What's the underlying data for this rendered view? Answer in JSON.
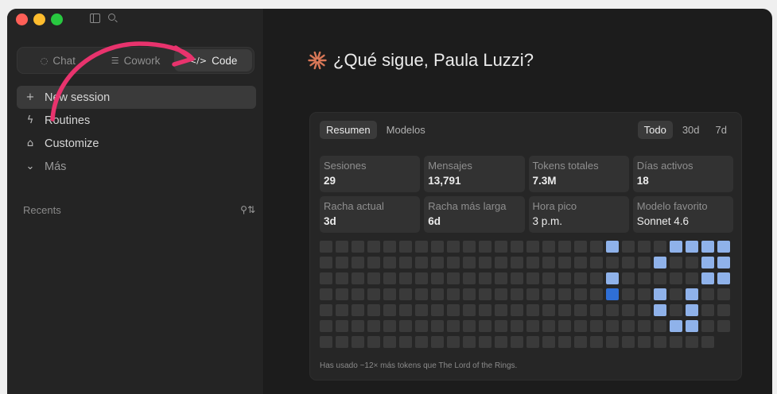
{
  "sidebar": {
    "modes": [
      {
        "icon": "chat-bubbles-icon",
        "glyph": "◌",
        "label": "Chat"
      },
      {
        "icon": "list-icon",
        "glyph": "☰",
        "label": "Cowork"
      },
      {
        "icon": "code-icon",
        "glyph": "</>",
        "label": "Code"
      }
    ],
    "nav": [
      {
        "icon": "plus-icon",
        "glyph": "+",
        "label": "New session"
      },
      {
        "icon": "bolt-icon",
        "glyph": "ϟ",
        "label": "Routines"
      },
      {
        "icon": "briefcase-icon",
        "glyph": "⌂",
        "label": "Customize"
      },
      {
        "icon": "chevron-down-icon",
        "glyph": "⌄",
        "label": "Más"
      }
    ],
    "recents_label": "Recents"
  },
  "main": {
    "greeting": "¿Qué sigue, Paula Luzzi?",
    "accent": "#d97757"
  },
  "stats_card": {
    "tabs_left": [
      "Resumen",
      "Modelos"
    ],
    "tabs_right": [
      "Todo",
      "30d",
      "7d"
    ],
    "stats": [
      {
        "label": "Sesiones",
        "value": "29"
      },
      {
        "label": "Mensajes",
        "value": "13,791"
      },
      {
        "label": "Tokens totales",
        "value": "7.3M"
      },
      {
        "label": "Días activos",
        "value": "18"
      },
      {
        "label": "Racha actual",
        "value": "3d"
      },
      {
        "label": "Racha más larga",
        "value": "6d"
      },
      {
        "label": "Hora pico",
        "value": "3 p.m."
      },
      {
        "label": "Modelo favorito",
        "value": "Sonnet 4.6"
      }
    ],
    "footnote": "Has usado ~12× más tokens que The Lord of the Rings.",
    "heatmap": {
      "weeks": 26,
      "days": 7,
      "colors": {
        "empty": "#3a3a3a",
        "light": "#8fb2ea",
        "strong": "#2f6fd6"
      },
      "active": [
        {
          "week": 18,
          "day": 0,
          "level": "light"
        },
        {
          "week": 18,
          "day": 2,
          "level": "light"
        },
        {
          "week": 18,
          "day": 3,
          "level": "strong"
        },
        {
          "week": 21,
          "day": 1,
          "level": "light"
        },
        {
          "week": 21,
          "day": 3,
          "level": "light"
        },
        {
          "week": 21,
          "day": 4,
          "level": "light"
        },
        {
          "week": 22,
          "day": 0,
          "level": "light"
        },
        {
          "week": 22,
          "day": 5,
          "level": "light"
        },
        {
          "week": 23,
          "day": 0,
          "level": "light"
        },
        {
          "week": 23,
          "day": 3,
          "level": "light"
        },
        {
          "week": 23,
          "day": 4,
          "level": "light"
        },
        {
          "week": 23,
          "day": 5,
          "level": "light"
        },
        {
          "week": 24,
          "day": 0,
          "level": "light"
        },
        {
          "week": 24,
          "day": 1,
          "level": "light"
        },
        {
          "week": 24,
          "day": 2,
          "level": "light"
        },
        {
          "week": 25,
          "day": 0,
          "level": "light"
        },
        {
          "week": 25,
          "day": 1,
          "level": "light"
        },
        {
          "week": 25,
          "day": 2,
          "level": "light"
        }
      ],
      "last_week_days": 6
    }
  },
  "annotation": {
    "arrow_color": "#e8336d"
  }
}
